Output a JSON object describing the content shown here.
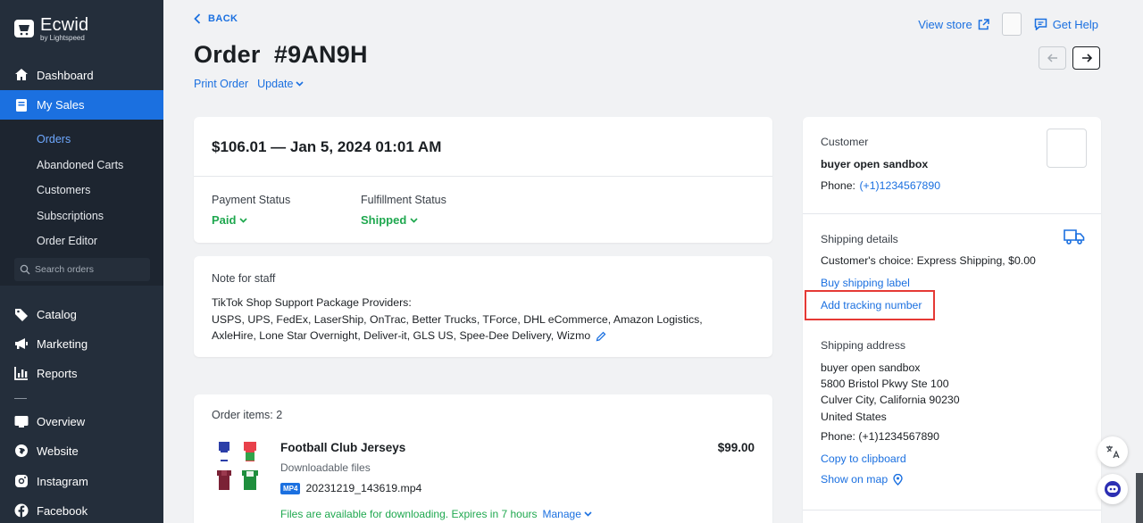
{
  "brand": {
    "name": "Ecwid",
    "sub": "by Lightspeed"
  },
  "sidebar": {
    "items": [
      {
        "label": "Dashboard",
        "icon": "home-icon"
      },
      {
        "label": "My Sales",
        "icon": "sales-icon"
      },
      {
        "label": "Catalog",
        "icon": "tag-icon"
      },
      {
        "label": "Marketing",
        "icon": "megaphone-icon"
      },
      {
        "label": "Reports",
        "icon": "chart-icon"
      },
      {
        "label": "Overview",
        "icon": "overview-icon"
      },
      {
        "label": "Website",
        "icon": "globe-icon"
      },
      {
        "label": "Instagram",
        "icon": "instagram-icon"
      },
      {
        "label": "Facebook",
        "icon": "facebook-icon"
      }
    ],
    "sub_items": [
      "Orders",
      "Abandoned Carts",
      "Customers",
      "Subscriptions",
      "Order Editor"
    ],
    "search_placeholder": "Search orders"
  },
  "header": {
    "back": "BACK",
    "view_store": "View store",
    "get_help": "Get Help",
    "title": "Order  #9AN9H",
    "print_order": "Print Order",
    "update": "Update"
  },
  "summary": {
    "headline": "$106.01 — Jan 5, 2024 01:01 AM",
    "payment_label": "Payment Status",
    "payment_value": "Paid",
    "fulfillment_label": "Fulfillment Status",
    "fulfillment_value": "Shipped"
  },
  "note": {
    "title": "Note for staff",
    "line1": "TikTok Shop Support Package Providers:",
    "line2": "USPS, UPS, FedEx, LaserShip, OnTrac, Better Trucks, TForce, DHL eCommerce, Amazon Logistics, AxleHire, Lone Star Overnight, Deliver-it, GLS US, Spee-Dee Delivery, Wizmo"
  },
  "items": {
    "title": "Order items: 2",
    "product_name": "Football Club Jerseys",
    "price": "$99.00",
    "subtitle": "Downloadable files",
    "file_badge": "MP4",
    "file_name": "20231219_143619.mp4",
    "files_note": "Files are available for downloading. Expires in 7 hours",
    "manage": "Manage"
  },
  "customer": {
    "label": "Customer",
    "name": "buyer open sandbox",
    "phone_label": "Phone:",
    "phone": "(+1)1234567890"
  },
  "shipping": {
    "label": "Shipping details",
    "choice": "Customer's choice: Express Shipping, $0.00",
    "buy_label": "Buy shipping label",
    "add_tracking": "Add tracking number",
    "address_label": "Shipping address",
    "addr_name": "buyer open sandbox",
    "addr_line1": "5800 Bristol Pkwy Ste 100",
    "addr_line2": "Culver City, California 90230",
    "addr_country": "United States",
    "addr_phone": "Phone: (+1)1234567890",
    "copy": "Copy to clipboard",
    "show_map": "Show on map"
  },
  "colors": {
    "accent": "#1b70e0",
    "sidebar": "#242e3b",
    "success": "#1fa84f",
    "highlight": "#e53935"
  }
}
